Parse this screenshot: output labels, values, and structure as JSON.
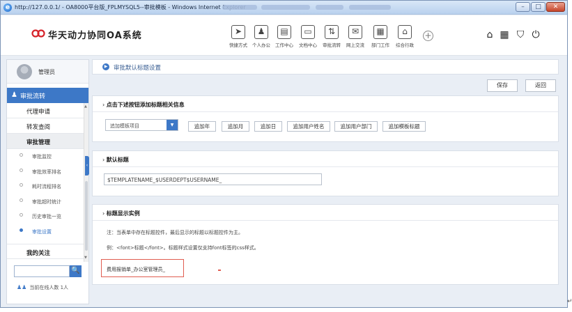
{
  "window": {
    "title": "http://127.0.0.1/ - OA8000平台版_FPLMYSQL5--审批模板 - Windows Internet Explorer",
    "minimize": "–",
    "maximize": "□",
    "close": "✕"
  },
  "header": {
    "app_title": "华天动力协同OA系统",
    "nav": [
      {
        "label": "快捷方式",
        "icon": "send-icon",
        "glyph": "➤"
      },
      {
        "label": "个人办公",
        "icon": "person-icon",
        "glyph": "♟"
      },
      {
        "label": "工作中心",
        "icon": "briefcase-icon",
        "glyph": "▤"
      },
      {
        "label": "文档中心",
        "icon": "document-icon",
        "glyph": "▭"
      },
      {
        "label": "审批流转",
        "icon": "flow-icon",
        "glyph": "⇅"
      },
      {
        "label": "网上交流",
        "icon": "chat-icon",
        "glyph": "✉"
      },
      {
        "label": "部门工作",
        "icon": "department-icon",
        "glyph": "▦"
      },
      {
        "label": "综合行政",
        "icon": "admin-icon",
        "glyph": "⌂"
      }
    ],
    "plus": "+",
    "top_icons": [
      {
        "name": "home-icon",
        "glyph": "⌂"
      },
      {
        "name": "grid-icon",
        "glyph": "▦"
      },
      {
        "name": "shirt-icon",
        "glyph": "⛉"
      },
      {
        "name": "power-icon",
        "glyph": "⏻"
      }
    ]
  },
  "sidebar": {
    "user_name": "管理员",
    "section_title": "审批流转",
    "items": [
      {
        "label": "代理申请"
      },
      {
        "label": "转发查阅"
      },
      {
        "label": "审批管理"
      }
    ],
    "sub_items": [
      {
        "label": "审批监控",
        "active": false
      },
      {
        "label": "审批效率排名",
        "active": false
      },
      {
        "label": "耗时流程排名",
        "active": false
      },
      {
        "label": "审批超时统计",
        "active": false
      },
      {
        "label": "历史审批一览",
        "active": false
      },
      {
        "label": "审批设置",
        "active": true
      }
    ],
    "last_item": "我的关注",
    "online_text": "当前在线人数",
    "online_count": "1人",
    "search_icon": "🔍"
  },
  "main": {
    "breadcrumb": "审批默认标题设置",
    "save_label": "保存",
    "back_label": "返回",
    "panel1": {
      "title": "点击下述按钮添加标题相关信息",
      "select_value": "追加模板项目",
      "buttons": [
        "追加年",
        "追加月",
        "追加日",
        "追加用户姓名",
        "追加用户部门",
        "追加模板标题"
      ]
    },
    "panel2": {
      "title": "默认标题",
      "input_value": "$TEMPLATENAME_$USERDEPT$USERNAME_"
    },
    "panel3": {
      "title": "标题显示实例",
      "note1": "注：当表单中存在标题控件，最后显示的标题以标题控件为主。",
      "note2": "例：<font>标题</font>。标题样式设置仅支持font标签的css样式。",
      "example": "费用报销单_办公室管理员_"
    }
  },
  "colors": {
    "accent": "#3d78c7",
    "highlight_border": "#e05c50"
  }
}
